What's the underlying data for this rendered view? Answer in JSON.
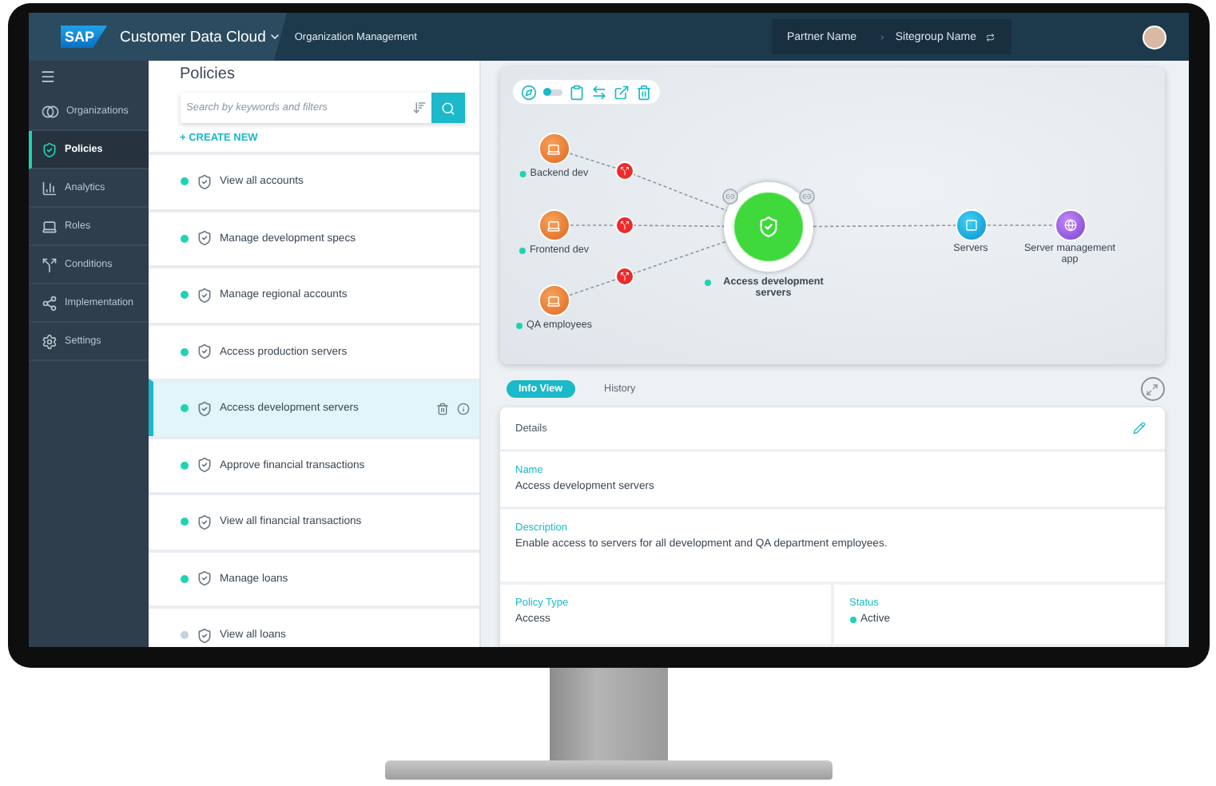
{
  "top_bar": {
    "logo": "SAP",
    "product": "Customer Data Cloud",
    "section": "Organization Management",
    "breadcrumb": [
      "Partner Name",
      "Sitegroup Name"
    ]
  },
  "sidebar": {
    "items": [
      {
        "label": "Organizations",
        "selected": false
      },
      {
        "label": "Policies",
        "selected": true
      },
      {
        "label": "Analytics",
        "selected": false
      },
      {
        "label": "Roles",
        "selected": false
      },
      {
        "label": "Conditions",
        "selected": false
      },
      {
        "label": "Implementation",
        "selected": false
      },
      {
        "label": "Settings",
        "selected": false
      }
    ]
  },
  "policies": {
    "title": "Policies",
    "search": {
      "placeholder": "Search by keywords and filters"
    },
    "create_label": "+ CREATE NEW",
    "items": [
      {
        "label": "View all accounts",
        "color": "#1ed3b3",
        "selected": false
      },
      {
        "label": "Manage development specs",
        "color": "#1ed3b3",
        "selected": false
      },
      {
        "label": "Manage regional accounts",
        "color": "#1ed3b3",
        "selected": false
      },
      {
        "label": "Access production servers",
        "color": "#1ed3b3",
        "selected": false
      },
      {
        "label": "Access development servers",
        "color": "#1ed3b3",
        "selected": true
      },
      {
        "label": "Approve financial transactions",
        "color": "#1ed3b3",
        "selected": false
      },
      {
        "label": "View all financial transactions",
        "color": "#1ed3b3",
        "selected": false
      },
      {
        "label": "Manage loans",
        "color": "#1ed3b3",
        "selected": false
      },
      {
        "label": "View all loans",
        "color": "#c5d2df",
        "selected": false
      }
    ]
  },
  "diagram": {
    "toolbar": {
      "toggle_on": false
    },
    "sources": [
      {
        "label": "Backend dev"
      },
      {
        "label": "Frontend dev"
      },
      {
        "label": "QA employees"
      }
    ],
    "policy": {
      "label": "Access development servers"
    },
    "targets": [
      {
        "label": "Servers",
        "kind": "server"
      },
      {
        "label": "Server management app",
        "kind": "app"
      }
    ]
  },
  "tabs": [
    {
      "label": "Info View",
      "selected": true
    },
    {
      "label": "History",
      "selected": false
    }
  ],
  "details": {
    "title": "Details",
    "fields": [
      {
        "label": "Name",
        "value": "Access development servers",
        "kind": "text"
      },
      {
        "label": "Description",
        "value": "Enable access to servers for all development and QA department employees.",
        "kind": "text"
      }
    ],
    "columns": [
      {
        "label": "Policy Type",
        "value": "Access",
        "kind": "text"
      },
      {
        "label": "Status",
        "value": "Active",
        "kind": "status"
      }
    ]
  }
}
